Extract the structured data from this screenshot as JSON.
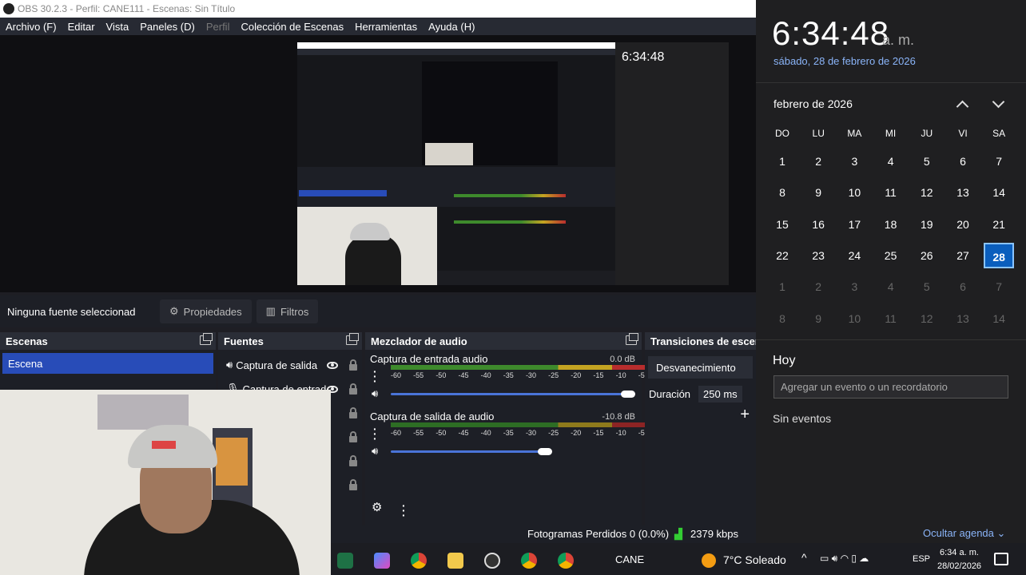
{
  "titlebar": {
    "title": "OBS 30.2.3 - Perfil: CANE111 - Escenas: Sin Título"
  },
  "menu": [
    {
      "label": "Archivo (F)"
    },
    {
      "label": "Editar"
    },
    {
      "label": "Vista"
    },
    {
      "label": "Paneles (D)"
    },
    {
      "label": "Perfil"
    },
    {
      "label": "Colección de Escenas"
    },
    {
      "label": "Herramientas"
    },
    {
      "label": "Ayuda (H)"
    }
  ],
  "toolbar": {
    "no_source": "Ninguna fuente seleccionad",
    "properties": "Propiedades",
    "filters": "Filtros"
  },
  "scenes": {
    "title": "Escenas",
    "items": [
      "Escena"
    ]
  },
  "sources": {
    "title": "Fuentes",
    "items": [
      "Captura de salida",
      "Captura de entrad"
    ]
  },
  "mixer": {
    "title": "Mezclador de audio",
    "channels": [
      {
        "name": "Captura de entrada audio",
        "db": "0.0 dB",
        "volume_pct": 97
      },
      {
        "name": "Captura de salida de audio",
        "db": "-10.8 dB",
        "volume_pct": 65
      }
    ],
    "ticks": [
      "-60",
      "-55",
      "-50",
      "-45",
      "-40",
      "-35",
      "-30",
      "-25",
      "-20",
      "-15",
      "-10",
      "-5",
      "0"
    ]
  },
  "transitions": {
    "title": "Transiciones de escer",
    "selected": "Desvanecimiento",
    "duration_label": "Duración",
    "duration_value": "250 ms"
  },
  "status": {
    "dropped": "Fotogramas Perdidos 0 (0.0%)",
    "bitrate": "2379 kbps"
  },
  "taskbar": {
    "user": "CANE",
    "weather": "7°C  Soleado",
    "lang": "ESP",
    "time": "6:34 a. m.",
    "date": "28/02/2026"
  },
  "calendar": {
    "time": "6:34:48",
    "ampm": "a. m.",
    "date_long": "sábado, 28 de febrero de 2026",
    "month": "febrero de 2026",
    "weekdays": [
      "DO",
      "LU",
      "MA",
      "MI",
      "JU",
      "VI",
      "SA"
    ],
    "selected_day": "28",
    "today_label": "Hoy",
    "event_placeholder": "Agregar un evento o un recordatorio",
    "no_events": "Sin eventos",
    "hide_agenda": "Ocultar agenda"
  }
}
